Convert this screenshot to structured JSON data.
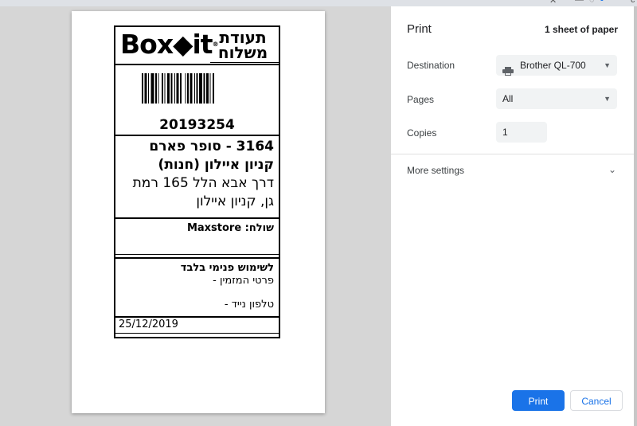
{
  "label": {
    "logo_text": "Box◆it",
    "logo_mark": "®",
    "doc_title": "תעודת משלוח",
    "tracking_number": "20193254",
    "destination_line1": "3164 - סופר פארם",
    "destination_line2": "קניון איילון (חנות)",
    "destination_line3": "דרך אבא הלל 165 רמת גן, קניון איילון",
    "sender": "שולח: Maxstore",
    "internal_title": "לשימוש פנימי בלבד",
    "orderer_details": "פרטי המזמין -",
    "mobile_phone": "טלפון נייד -",
    "date": "25/12/2019"
  },
  "panel": {
    "title": "Print",
    "sheet_count": "1 sheet of paper",
    "destination_label": "Destination",
    "destination_value": "Brother QL-700",
    "pages_label": "Pages",
    "pages_value": "All",
    "copies_label": "Copies",
    "copies_value": "1",
    "more_settings": "More settings",
    "print_button": "Print",
    "cancel_button": "Cancel"
  },
  "icons": {
    "printer": "printer-icon",
    "dropdown": "caret-down-icon",
    "expand": "chevron-down-icon"
  },
  "colors": {
    "accent": "#1a73e8",
    "panel_bg": "#ffffff",
    "preview_bg": "#d6d6d6"
  }
}
